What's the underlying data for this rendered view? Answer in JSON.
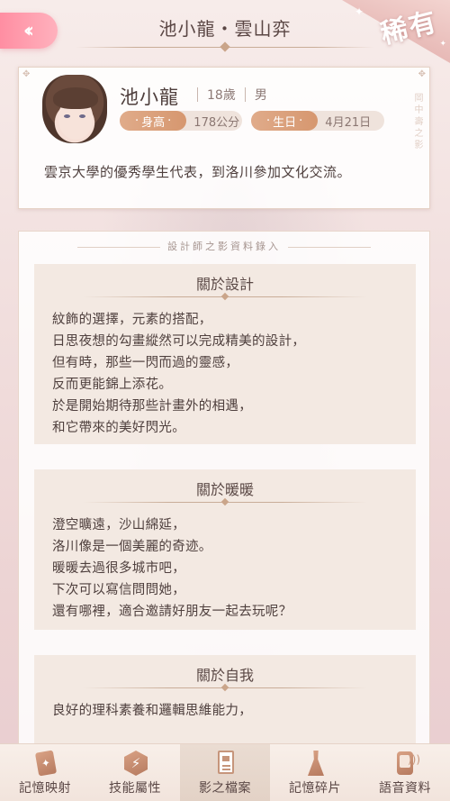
{
  "header": {
    "back_icon": "double-chevron-left-icon",
    "title": "池小龍・雲山弈",
    "rarity": "稀有"
  },
  "profile": {
    "name": "池小龍",
    "age": "18歲",
    "gender": "男",
    "height_label": "身高",
    "height_value": "178公分",
    "birthday_label": "生日",
    "birthday_value": "4月21日",
    "side_text": "岡中壽之影",
    "bio": "雲京大學的優秀學生代表，到洛川參加文化交流。"
  },
  "records": {
    "heading": "設計師之影資料錄入",
    "sections": [
      {
        "title": "關於設計",
        "lines": [
          "紋飾的選擇，元素的搭配，",
          "日思夜想的勾畫縱然可以完成精美的設計，",
          "但有時，那些一閃而過的靈感，",
          "反而更能錦上添花。",
          "於是開始期待那些計畫外的相遇，",
          "和它帶來的美好閃光。"
        ]
      },
      {
        "title": "關於暖暖",
        "lines": [
          "澄空曠遠，沙山綿延，",
          "洛川像是一個美麗的奇迹。",
          "暖暖去過很多城市吧，",
          "下次可以寫信問問她，",
          "還有哪裡，適合邀請好朋友一起去玩呢？"
        ]
      },
      {
        "title": "關於自我",
        "lines": [
          "良好的理科素養和邏輯思維能力，"
        ]
      }
    ]
  },
  "nav": {
    "items": [
      {
        "label": "記憶映射",
        "icon": "memory-card-icon"
      },
      {
        "label": "技能屬性",
        "icon": "skill-hex-icon"
      },
      {
        "label": "影之檔案",
        "icon": "document-icon",
        "active": true
      },
      {
        "label": "記憶碎片",
        "icon": "dress-icon"
      },
      {
        "label": "語音資料",
        "icon": "voice-phone-icon"
      }
    ]
  },
  "colors": {
    "accent_pink": "#ff8ea2",
    "tag_orange": "#d6976f",
    "text_dark": "#4f403e"
  }
}
